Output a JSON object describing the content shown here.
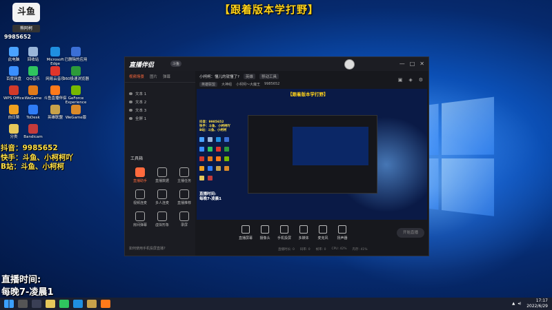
{
  "overlay": {
    "top_banner": "【跟着版本学打野】",
    "logo_text": "斗鱼",
    "logo_sub": "熊阿柯",
    "logo_id": "9985652",
    "promo_lines": [
      "抖音：9985652",
      "快手：斗鱼、小柯柯吖",
      "B站：斗鱼、小柯柯"
    ],
    "schedule_lines": [
      "直播时间:",
      "每晚7-凌晨1"
    ]
  },
  "desktop_icons": [
    {
      "label": "此电脑",
      "color": "#4aa3ff"
    },
    {
      "label": "回收站",
      "color": "#9ab6d9"
    },
    {
      "label": "Microsoft Edge",
      "color": "#1f8fe0"
    },
    {
      "label": "已删除的应用",
      "color": "#3b6fd6"
    },
    {
      "label": "百度网盘",
      "color": "#3a8fff"
    },
    {
      "label": "QQ音乐",
      "color": "#2fc45e"
    },
    {
      "label": "网易云音乐",
      "color": "#e0352b"
    },
    {
      "label": "360极速浏览器",
      "color": "#2d9a3a"
    },
    {
      "label": "WPS Office",
      "color": "#d23a2a"
    },
    {
      "label": "WeGame",
      "color": "#e07a1a"
    },
    {
      "label": "斗鱼直播伴侣",
      "color": "#ff7a1a"
    },
    {
      "label": "GeForce Experience",
      "color": "#76b900"
    },
    {
      "label": "向日葵",
      "color": "#f0a020"
    },
    {
      "label": "ToDesk",
      "color": "#2f7cf6"
    },
    {
      "label": "英雄联盟",
      "color": "#c8a24a"
    },
    {
      "label": "WeGame版",
      "color": "#d98a2a"
    },
    {
      "label": "分类",
      "color": "#e6c85a"
    },
    {
      "label": "Bandicam",
      "color": "#c43b3b"
    }
  ],
  "app": {
    "name": "直播伴侣",
    "badge": "斗鱼",
    "window_controls": [
      "—",
      "□",
      "✕"
    ],
    "left_tabs": [
      "视频场景",
      "图片",
      "弹幕"
    ],
    "scenes": [
      "文本 1",
      "文本 2",
      "文本 3",
      "全屏 1"
    ],
    "tools_title": "工具箱",
    "tools": [
      {
        "label": "直播助手",
        "highlight": true
      },
      {
        "label": "直播数据",
        "highlight": false
      },
      {
        "label": "主播任务",
        "highlight": false
      },
      {
        "label": "视频连麦",
        "highlight": false
      },
      {
        "label": "多人连麦",
        "highlight": false
      },
      {
        "label": "直播推荐",
        "highlight": false
      },
      {
        "label": "房间弹幕",
        "highlight": false
      },
      {
        "label": "虚拟形象",
        "highlight": false
      },
      {
        "label": "录屏",
        "highlight": false
      }
    ],
    "left_footer": "如何使用手机投屏直播?",
    "top_info": [
      "小柯柯：懂儿的就懂了?",
      "英雄",
      "移动工具"
    ],
    "top_info2": [
      "英雄联盟",
      "大神组",
      "小柯柯～大魔王",
      "9985652"
    ],
    "preview_banner": "【跟着版本学打野】",
    "preview_text": [
      "直播时间:",
      "每晚7-凌晨1"
    ],
    "bottom_tools": [
      "直播屏幕",
      "摄像头",
      "手机投屏",
      "多媒体",
      "麦克风",
      "扬声器"
    ],
    "go_live": "开始直播",
    "status": [
      "直播时长: 0",
      "码率: 0",
      "帧率: 0",
      "CPU: 42%",
      "内存: 41%"
    ]
  },
  "taskbar": {
    "time": "17:17",
    "date": "2022/6/29"
  }
}
